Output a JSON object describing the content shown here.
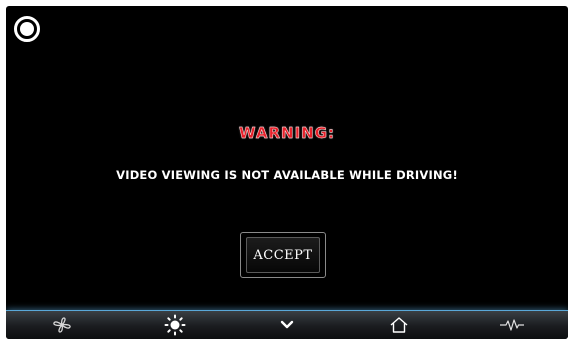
{
  "dialog": {
    "title": "WARNING:",
    "message": "VIDEO VIEWING IS NOT AVAILABLE  WHILE DRIVING!",
    "accept_label": "ACCEPT"
  },
  "bottom_bar": {
    "items": [
      {
        "icon": "fan-icon"
      },
      {
        "icon": "brightness-icon"
      },
      {
        "icon": "chevron-down-icon"
      },
      {
        "icon": "home-icon"
      },
      {
        "icon": "pulse-icon"
      }
    ]
  },
  "colors": {
    "background": "#000000",
    "warning": "#e8202a",
    "text": "#ffffff",
    "bar_glow": "#5aa8d8"
  }
}
